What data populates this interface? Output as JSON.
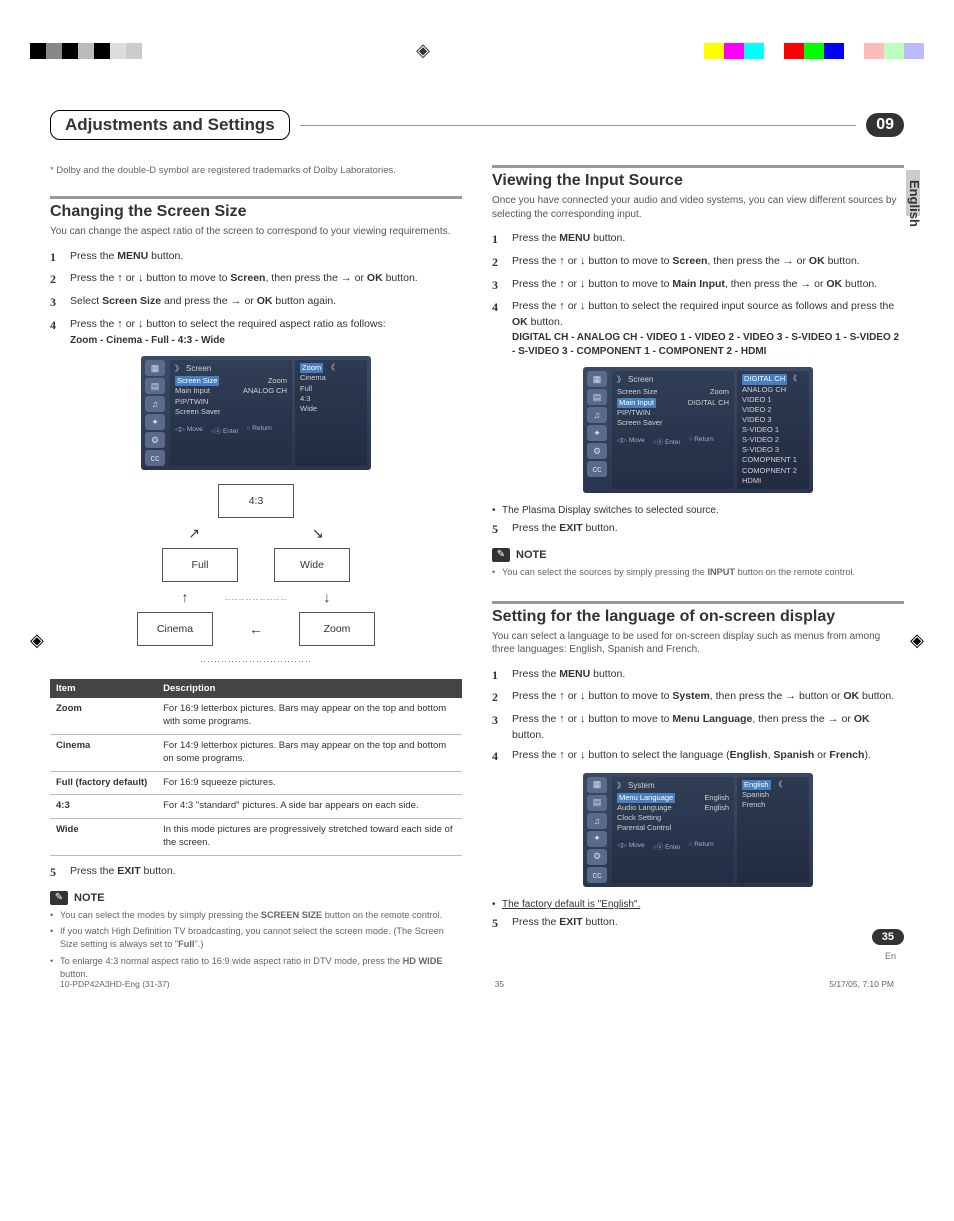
{
  "header": {
    "title": "Adjustments and Settings",
    "chapter": "09"
  },
  "side_tab": "English",
  "footnote": "* Dolby and the double-D symbol are registered trademarks of Dolby Laboratories.",
  "section_left": {
    "title": "Changing the Screen Size",
    "intro": "You can change the aspect ratio of the screen to correspond to your viewing requirements.",
    "steps": {
      "s1": {
        "num": "1",
        "text_a": "Press the ",
        "b": "MENU",
        "text_b": " button."
      },
      "s2": {
        "num": "2",
        "text_a": "Press the ",
        "mid": " or ",
        "text_b": " button to move to ",
        "b": "Screen",
        "text_c": ", then press the ",
        "mid2": " or ",
        "b2": "OK",
        "text_d": " button."
      },
      "s3": {
        "num": "3",
        "text_a": "Select ",
        "b": "Screen Size",
        "text_b": " and press the ",
        "mid": " or ",
        "b2": "OK",
        "text_c": " button again."
      },
      "s4": {
        "num": "4",
        "text_a": "Press the ",
        "mid": " or ",
        "text_b": " button to select the required aspect ratio as follows:",
        "sub": "Zoom - Cinema - Full - 4:3 - Wide"
      },
      "s5": {
        "num": "5",
        "text_a": "Press the ",
        "b": "EXIT",
        "text_b": " button."
      }
    },
    "osd": {
      "title": "Screen",
      "rows": [
        {
          "label": "Screen Size",
          "value": "Zoom"
        },
        {
          "label": "Main Input",
          "value": "ANALOG CH"
        },
        {
          "label": "PIP/TWIN",
          "value": ""
        },
        {
          "label": "Screen Saver",
          "value": ""
        }
      ],
      "pop": [
        "Zoom",
        "Cinema",
        "Full",
        "4:3",
        "Wide"
      ],
      "footer": [
        "Move",
        "Enter",
        "Return"
      ]
    },
    "diagram": {
      "top": "4:3",
      "left1": "Full",
      "right1": "Wide",
      "left2": "Cinema",
      "right2": "Zoom"
    },
    "table": {
      "head": [
        "Item",
        "Description"
      ],
      "rows": [
        [
          "Zoom",
          "For 16:9 letterbox pictures. Bars may appear on the top and bottom with some programs."
        ],
        [
          "Cinema",
          "For 14:9 letterbox pictures. Bars may appear on the top and bottom on some programs."
        ],
        [
          "Full (factory default)",
          "For 16:9 squeeze pictures."
        ],
        [
          "4:3",
          "For 4:3 \"standard\" pictures. A side bar appears on each side."
        ],
        [
          "Wide",
          "In this mode pictures are progressively stretched toward each side of the screen."
        ]
      ]
    },
    "note_label": "NOTE",
    "notes": [
      {
        "pre": "You can select the modes by simply pressing the ",
        "b": "SCREEN SIZE",
        "post": " button on the remote control."
      },
      {
        "pre": "If you watch High Definition TV broadcasting, you cannot select the screen mode. (The Screen Size setting is always set to \"",
        "b": "Full",
        "post": "\".)"
      },
      {
        "pre": "To enlarge 4:3 normal aspect ratio to 16:9 wide aspect ratio in DTV mode, press the ",
        "b": "HD WIDE",
        "post": " button."
      }
    ]
  },
  "section_right_a": {
    "title": "Viewing the Input Source",
    "intro": "Once you have connected your audio and video systems, you can view different sources by selecting the corresponding input.",
    "s1": {
      "num": "1",
      "text_a": "Press the ",
      "b": "MENU",
      "text_b": " button."
    },
    "s2": {
      "num": "2",
      "text_a": "Press the ",
      "mid": " or ",
      "text_b": " button to move to ",
      "b": "Screen",
      "text_c": ", then press the ",
      "mid2": " or ",
      "b2": "OK",
      "text_d": " button."
    },
    "s3": {
      "num": "3",
      "text_a": "Press the ",
      "mid": " or ",
      "text_b": " button to move to ",
      "b": "Main Input",
      "text_c": ", then press the ",
      "mid2": " or ",
      "b2": "OK",
      "text_d": " button."
    },
    "s4": {
      "num": "4",
      "text_a": "Press the ",
      "mid": " or ",
      "text_b": " button to select the required input source as follows and press the ",
      "b": "OK",
      "text_c": " button.",
      "sub": "DIGITAL CH - ANALOG CH - VIDEO 1 - VIDEO 2 - VIDEO 3 - S-VIDEO 1 - S-VIDEO 2 - S-VIDEO 3 - COMPONENT 1 - COMPONENT 2 - HDMI"
    },
    "s5": {
      "num": "5",
      "text_a": "Press the ",
      "b": "EXIT",
      "text_b": " button."
    },
    "osd": {
      "title": "Screen",
      "rows": [
        {
          "label": "Screen Size",
          "value": "Zoom"
        },
        {
          "label": "Main Input",
          "value": "DIGITAL CH"
        },
        {
          "label": "PIP/TWIN",
          "value": ""
        },
        {
          "label": "Screen Saver",
          "value": ""
        }
      ],
      "pop": [
        "DIGITAL CH",
        "ANALOG CH",
        "VIDEO 1",
        "VIDEO 2",
        "VIDEO 3",
        "S-VIDEO 1",
        "S-VIDEO 2",
        "S-VIDEO 3",
        "COMOPNENT 1",
        "COMOPNENT 2",
        "HDMI"
      ]
    },
    "bullet": "The Plasma Display switches to selected source.",
    "note_label": "NOTE",
    "note": {
      "pre": "You can select the sources by simply pressing the ",
      "b": "INPUT",
      "post": " button on the remote control."
    }
  },
  "section_right_b": {
    "title": "Setting for the language of on-screen display",
    "intro": "You can select a language to be used for on-screen display such as menus from among three languages: English, Spanish and French.",
    "s1": {
      "num": "1",
      "text_a": "Press the ",
      "b": "MENU",
      "text_b": " button."
    },
    "s2": {
      "num": "2",
      "text_a": "Press the ",
      "mid": " or ",
      "text_b": " button to move to ",
      "b": "System",
      "text_c": ", then press the ",
      "mid2": " button or ",
      "b2": "OK",
      "text_d": " button."
    },
    "s3": {
      "num": "3",
      "text_a": "Press the ",
      "mid": " or ",
      "text_b": " button to move to ",
      "b": "Menu Language",
      "text_c": ", then press the ",
      "mid2": " or ",
      "b2": "OK",
      "text_d": " button."
    },
    "s4": {
      "num": "4",
      "text_a": "Press the ",
      "mid": " or ",
      "text_b": " button to select the language (",
      "b": "English",
      "text_c": ", ",
      "b2": "Spanish",
      "text_d": " or ",
      "b3": "French",
      "text_e": ")."
    },
    "s5": {
      "num": "5",
      "text_a": "Press the ",
      "b": "EXIT",
      "text_b": " button."
    },
    "osd": {
      "title": "System",
      "rows": [
        {
          "label": "Menu Language",
          "value": "English"
        },
        {
          "label": "Audio Language",
          "value": "English"
        },
        {
          "label": "Clock Setting",
          "value": ""
        },
        {
          "label": "Parental Control",
          "value": ""
        }
      ],
      "pop": [
        "English",
        "Spanish",
        "French"
      ]
    },
    "bullet": "The factory default is \"English\"."
  },
  "page": {
    "num": "35",
    "lang": "En"
  },
  "footer": {
    "file": "10-PDP42A3HD-Eng (31-37)",
    "pg": "35",
    "ts": "5/17/05, 7:10 PM"
  }
}
